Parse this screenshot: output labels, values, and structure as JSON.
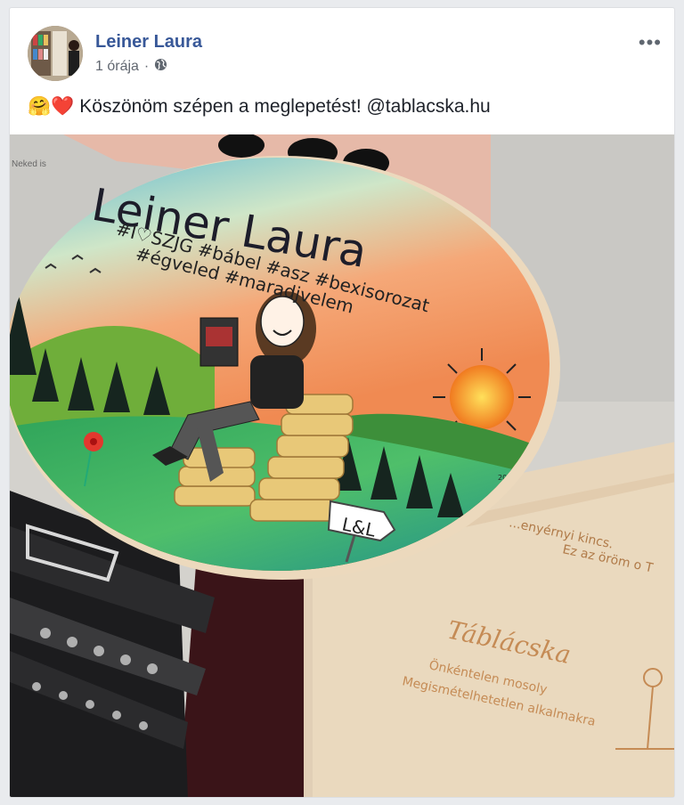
{
  "post": {
    "author": "Leiner Laura",
    "time": "1 órája",
    "separator": "·",
    "emojis": "🤗❤️",
    "text": "Köszönöm szépen a meglepetést! @tablacska.hu",
    "more_label": "•••"
  },
  "photo": {
    "sign_title": "Leiner Laura",
    "hashtags_line1": "#I♡SZJG  #bábel  #asz  #bexisorozat",
    "hashtags_line2": "#égveled  #maradjvelem",
    "signpost": "L&L",
    "box_text_line1": "...enyérnyi kincs.",
    "box_text_line2": "Ez az öröm o T",
    "brand": "Táblácska",
    "brand_sub1": "Önkéntelen mosoly",
    "brand_sub2": "Megismételhetetlen alkalmakra",
    "paper_text": "Neked is",
    "artist_sign": "2018"
  },
  "colors": {
    "link": "#385898",
    "meta": "#616770",
    "text": "#1d2129"
  }
}
